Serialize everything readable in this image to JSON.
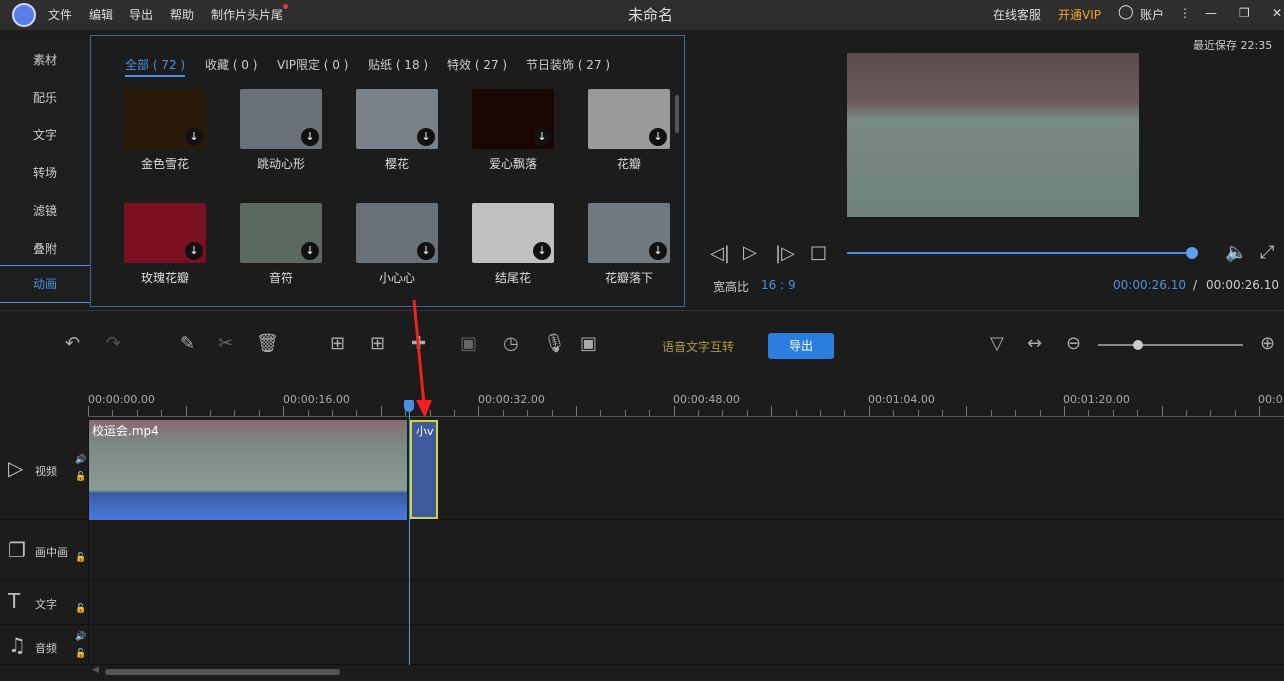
{
  "title_bar": {
    "menus": [
      "文件",
      "编辑",
      "导出",
      "帮助",
      "制作片头片尾"
    ],
    "title": "未命名",
    "support": "在线客服",
    "vip": "开通VIP",
    "account": "账户"
  },
  "sidebar": {
    "items": [
      "素材",
      "配乐",
      "文字",
      "转场",
      "滤镜",
      "叠附",
      "动画"
    ],
    "active": "动画"
  },
  "panel": {
    "categories": [
      "全部 ( 72 )",
      "收藏 ( 0 )",
      "VIP限定 ( 0 )",
      "贴纸 ( 18 )",
      "特效 ( 27 )",
      "节日装饰 ( 27 )"
    ],
    "items": [
      {
        "label": "金色雪花",
        "color": "#2a1a0a"
      },
      {
        "label": "跳动心形",
        "color": "#6a7078"
      },
      {
        "label": "樱花",
        "color": "#7a8088"
      },
      {
        "label": "爱心飘落",
        "color": "#1a0505"
      },
      {
        "label": "花瓣",
        "color": "#9a9a9a"
      },
      {
        "label": "玫瑰花瓣",
        "color": "#7a1020"
      },
      {
        "label": "音符",
        "color": "#5a6a60"
      },
      {
        "label": "小心心",
        "color": "#6a7078"
      },
      {
        "label": "结尾花",
        "color": "#c0c0c0"
      },
      {
        "label": "花瓣落下",
        "color": "#707880"
      }
    ]
  },
  "preview": {
    "last_saved": "最近保存 22:35",
    "aspect_label": "宽高比",
    "aspect_value": "16 : 9",
    "current_time": "00:00:26.10",
    "separator": "/",
    "total_time": "00:00:26.10",
    "progress": 1.0
  },
  "toolbar": {
    "speech_text": "语音文字互转",
    "export": "导出"
  },
  "timeline": {
    "ticks": [
      "00:00:00.00",
      "00:00:16.00",
      "00:00:32.00",
      "00:00:48.00",
      "00:01:04.00",
      "00:01:20.00",
      "00:0"
    ],
    "tracks": [
      "视频",
      "画中画",
      "文字",
      "音频"
    ],
    "clip_label": "校运会.mp4",
    "effect_clip_label": "小v"
  }
}
